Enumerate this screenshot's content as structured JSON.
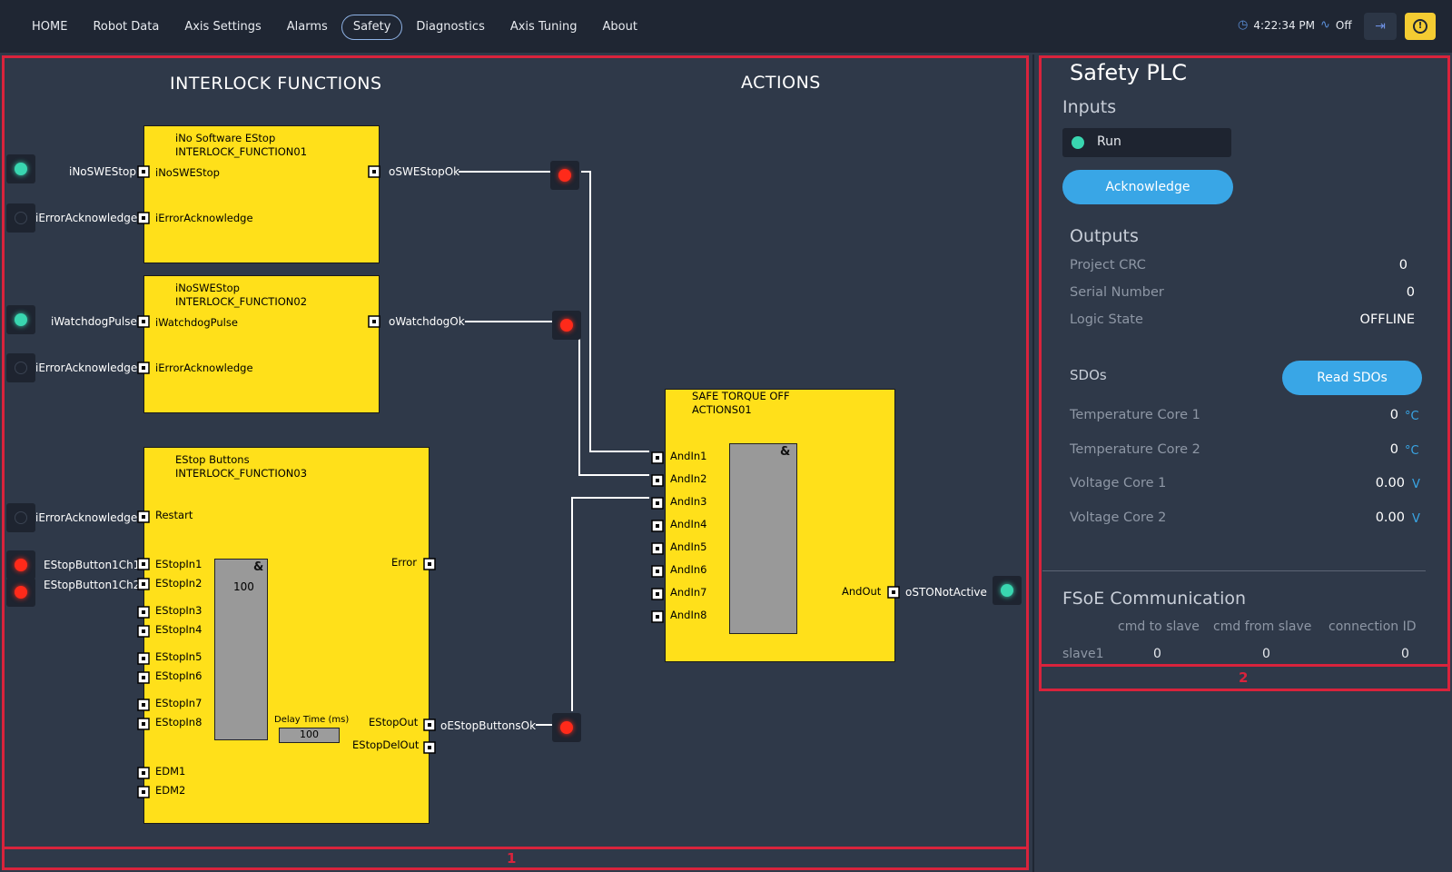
{
  "nav": {
    "items": [
      "HOME",
      "Robot Data",
      "Axis Settings",
      "Alarms",
      "Safety",
      "Diagnostics",
      "Axis Tuning",
      "About"
    ],
    "active": "Safety"
  },
  "status": {
    "time": "4:22:34 PM",
    "signal": "Off"
  },
  "regions": {
    "left_label": "1",
    "right_label": "2"
  },
  "diagram": {
    "heading_left": "INTERLOCK FUNCTIONS",
    "heading_right": "ACTIONS",
    "block1": {
      "title1": "iNo Software EStop",
      "title2": "INTERLOCK_FUNCTION01",
      "in1": "iNoSWEStop",
      "in2": "iErrorAcknowledge",
      "out1": "oSWEStopOk",
      "ext_in1": "iNoSWEStop",
      "ext_in2": "iErrorAcknowledge"
    },
    "block2": {
      "title1": "iNoSWEStop",
      "title2": "INTERLOCK_FUNCTION02",
      "in1": "iWatchdogPulse",
      "in2": "iErrorAcknowledge",
      "out1": "oWatchdogOk",
      "ext_in1": "iWatchdogPulse",
      "ext_in2": "iErrorAcknowledge"
    },
    "block3": {
      "title1": "EStop Buttons",
      "title2": "INTERLOCK_FUNCTION03",
      "restart": "Restart",
      "error": "Error",
      "inputs": [
        "EStopIn1",
        "EStopIn2",
        "EStopIn3",
        "EStopIn4",
        "EStopIn5",
        "EStopIn6",
        "EStopIn7",
        "EStopIn8"
      ],
      "edm1": "EDM1",
      "edm2": "EDM2",
      "gate_value": "100",
      "delay_label": "Delay Time (ms)",
      "delay_value": "100",
      "out1": "EStopOut",
      "out2": "EStopDelOut",
      "ext_restart": "iErrorAcknowledge",
      "ext_in1": "EStopButton1Ch1",
      "ext_in2": "EStopButton1Ch2",
      "ext_out": "oEStopButtonsOk"
    },
    "block4": {
      "title1": "SAFE TORQUE OFF",
      "title2": "ACTIONS01",
      "inputs": [
        "AndIn1",
        "AndIn2",
        "AndIn3",
        "AndIn4",
        "AndIn5",
        "AndIn6",
        "AndIn7",
        "AndIn8"
      ],
      "out": "AndOut",
      "ext_out": "oSTONotActive"
    },
    "gate_symbol": "&"
  },
  "plc": {
    "title": "Safety PLC",
    "inputs_heading": "Inputs",
    "run_label": "Run",
    "acknowledge": "Acknowledge",
    "outputs_heading": "Outputs",
    "project_crc": {
      "label": "Project CRC",
      "value": "0"
    },
    "serial_number": {
      "label": "Serial Number",
      "value": "0"
    },
    "logic_state": {
      "label": "Logic State",
      "value": "OFFLINE"
    },
    "sdos_heading": "SDOs",
    "read_sdos": "Read SDOs",
    "temp1": {
      "label": "Temperature Core 1",
      "value": "0",
      "unit": "°C"
    },
    "temp2": {
      "label": "Temperature Core 2",
      "value": "0",
      "unit": "°C"
    },
    "volt1": {
      "label": "Voltage Core 1",
      "value": "0.00",
      "unit": "V"
    },
    "volt2": {
      "label": "Voltage Core 2",
      "value": "0.00",
      "unit": "V"
    },
    "fsoe_heading": "FSoE Communication",
    "fsoe_cols": [
      "cmd to slave",
      "cmd from slave",
      "connection ID"
    ],
    "fsoe_rows": [
      {
        "name": "slave1",
        "values": [
          "0",
          "0",
          "0"
        ]
      }
    ]
  },
  "colors": {
    "accent": "#39a6e6",
    "block": "#ffe01a",
    "led_green": "#39d6b0",
    "led_red": "#ff2a1a",
    "region": "#d9233c"
  }
}
